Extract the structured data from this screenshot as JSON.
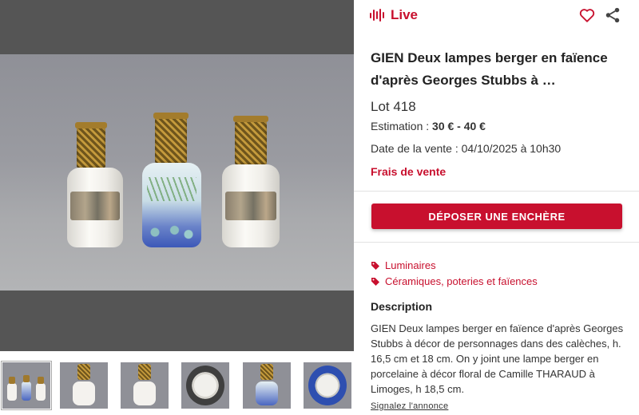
{
  "live": {
    "label": "Live"
  },
  "lot": {
    "title": "GIEN Deux lampes berger en faïence d'après Georges Stubbs à …",
    "number": "Lot 418",
    "estimation_label": "Estimation : ",
    "estimation_value": "30 € - 40 €",
    "sale_date": "Date de la vente : 04/10/2025 à 10h30",
    "fees_link": "Frais de vente"
  },
  "bid_button": {
    "label": "DÉPOSER UNE ENCHÈRE"
  },
  "categories": [
    {
      "label": "Luminaires"
    },
    {
      "label": "Céramiques, poteries et faïences"
    }
  ],
  "description": {
    "heading": "Description",
    "text": "GIEN Deux lampes berger en faïence d'après Georges Stubbs à décor de personnages dans des calèches, h. 16,5 cm et 18 cm. On y joint une lampe berger en porcelaine à décor floral de Camille THARAUD à Limoges, h 18,5 cm."
  },
  "report_link": "Signalez l'annonce",
  "icons": {
    "live": "audio-wave-icon",
    "favorite": "heart-outline-icon",
    "share": "share-icon",
    "category": "tag-icon"
  },
  "colors": {
    "accent": "#c8102e",
    "gallery_bg": "#555555"
  },
  "gallery": {
    "thumbnail_count": 6,
    "selected_thumbnail": 1
  }
}
